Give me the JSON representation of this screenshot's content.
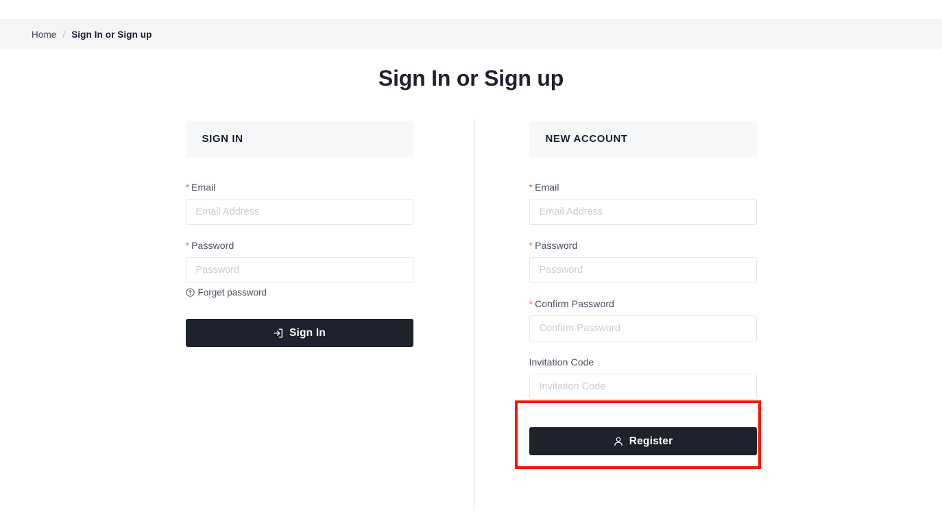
{
  "breadcrumb": {
    "home_label": "Home",
    "separator": "/",
    "current_label": "Sign In or Sign up"
  },
  "page": {
    "title": "Sign In or Sign up"
  },
  "signin_panel": {
    "heading": "SIGN IN",
    "email": {
      "label": "Email",
      "required_marker": "*",
      "placeholder": "Email Address",
      "value": ""
    },
    "password": {
      "label": "Password",
      "required_marker": "*",
      "placeholder": "Password",
      "value": ""
    },
    "forget_password": {
      "label": "Forget password",
      "icon": "question-circle-icon"
    },
    "submit": {
      "label": "Sign In",
      "icon": "login-arrow-icon"
    }
  },
  "register_panel": {
    "heading": "NEW ACCOUNT",
    "email": {
      "label": "Email",
      "required_marker": "*",
      "placeholder": "Email Address",
      "value": ""
    },
    "password": {
      "label": "Password",
      "required_marker": "*",
      "placeholder": "Password",
      "value": ""
    },
    "confirm_password": {
      "label": "Confirm Password",
      "required_marker": "*",
      "placeholder": "Confirm Password",
      "value": ""
    },
    "invitation_code": {
      "label": "Invitation Code",
      "placeholder": "Invitation Code",
      "value": "",
      "highlighted": true
    },
    "submit": {
      "label": "Register",
      "icon": "user-icon"
    }
  },
  "colors": {
    "button_dark": "#1e222d",
    "panel_header_bg": "#f7f8fa",
    "breadcrumb_bg": "#f5f5f6",
    "required_star": "#f1666b",
    "highlight_border": "#fb1505",
    "input_border": "#e6e7ea",
    "placeholder": "#c9ccd4"
  }
}
